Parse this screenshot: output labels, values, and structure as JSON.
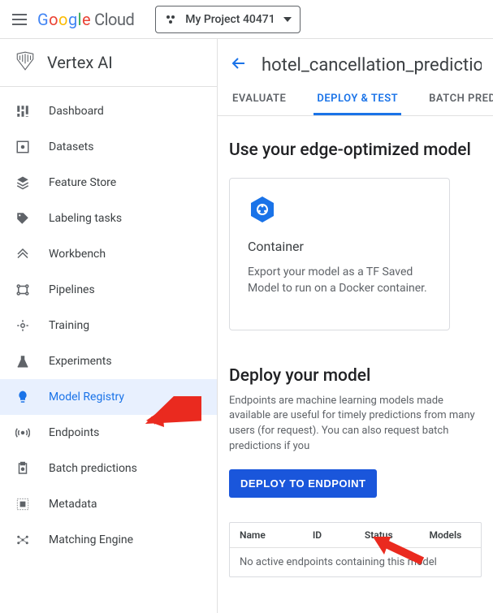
{
  "header": {
    "logo_text": "Google",
    "logo_suffix": "Cloud",
    "project_name": "My Project 40471"
  },
  "product": {
    "title": "Vertex AI"
  },
  "sidebar": {
    "items": [
      {
        "label": "Dashboard",
        "icon": "dashboard-icon"
      },
      {
        "label": "Datasets",
        "icon": "datasets-icon"
      },
      {
        "label": "Feature Store",
        "icon": "feature-store-icon"
      },
      {
        "label": "Labeling tasks",
        "icon": "tag-icon"
      },
      {
        "label": "Workbench",
        "icon": "workbench-icon"
      },
      {
        "label": "Pipelines",
        "icon": "pipelines-icon"
      },
      {
        "label": "Training",
        "icon": "training-icon"
      },
      {
        "label": "Experiments",
        "icon": "flask-icon"
      },
      {
        "label": "Model Registry",
        "icon": "lightbulb-icon"
      },
      {
        "label": "Endpoints",
        "icon": "endpoints-icon"
      },
      {
        "label": "Batch predictions",
        "icon": "batch-icon"
      },
      {
        "label": "Metadata",
        "icon": "metadata-icon"
      },
      {
        "label": "Matching Engine",
        "icon": "matching-icon"
      }
    ],
    "active_index": 8
  },
  "page": {
    "title": "hotel_cancellation_prediction"
  },
  "tabs": {
    "items": [
      "EVALUATE",
      "DEPLOY & TEST",
      "BATCH PREDICT"
    ],
    "active_index": 1
  },
  "edge_section": {
    "title": "Use your edge-optimized model",
    "card": {
      "title": "Container",
      "description": "Export your model as a TF Saved Model to run on a Docker container."
    }
  },
  "deploy_section": {
    "title": "Deploy your model",
    "description": "Endpoints are machine learning models made available are useful for timely predictions from many users (for request). You can also request batch predictions if you",
    "button_label": "DEPLOY TO ENDPOINT"
  },
  "table": {
    "columns": [
      "Name",
      "ID",
      "Status",
      "Models"
    ],
    "empty_message": "No active endpoints containing this model"
  },
  "colors": {
    "primary": "#1a73e8",
    "button": "#1a56db",
    "arrow": "#ea2a1f"
  }
}
